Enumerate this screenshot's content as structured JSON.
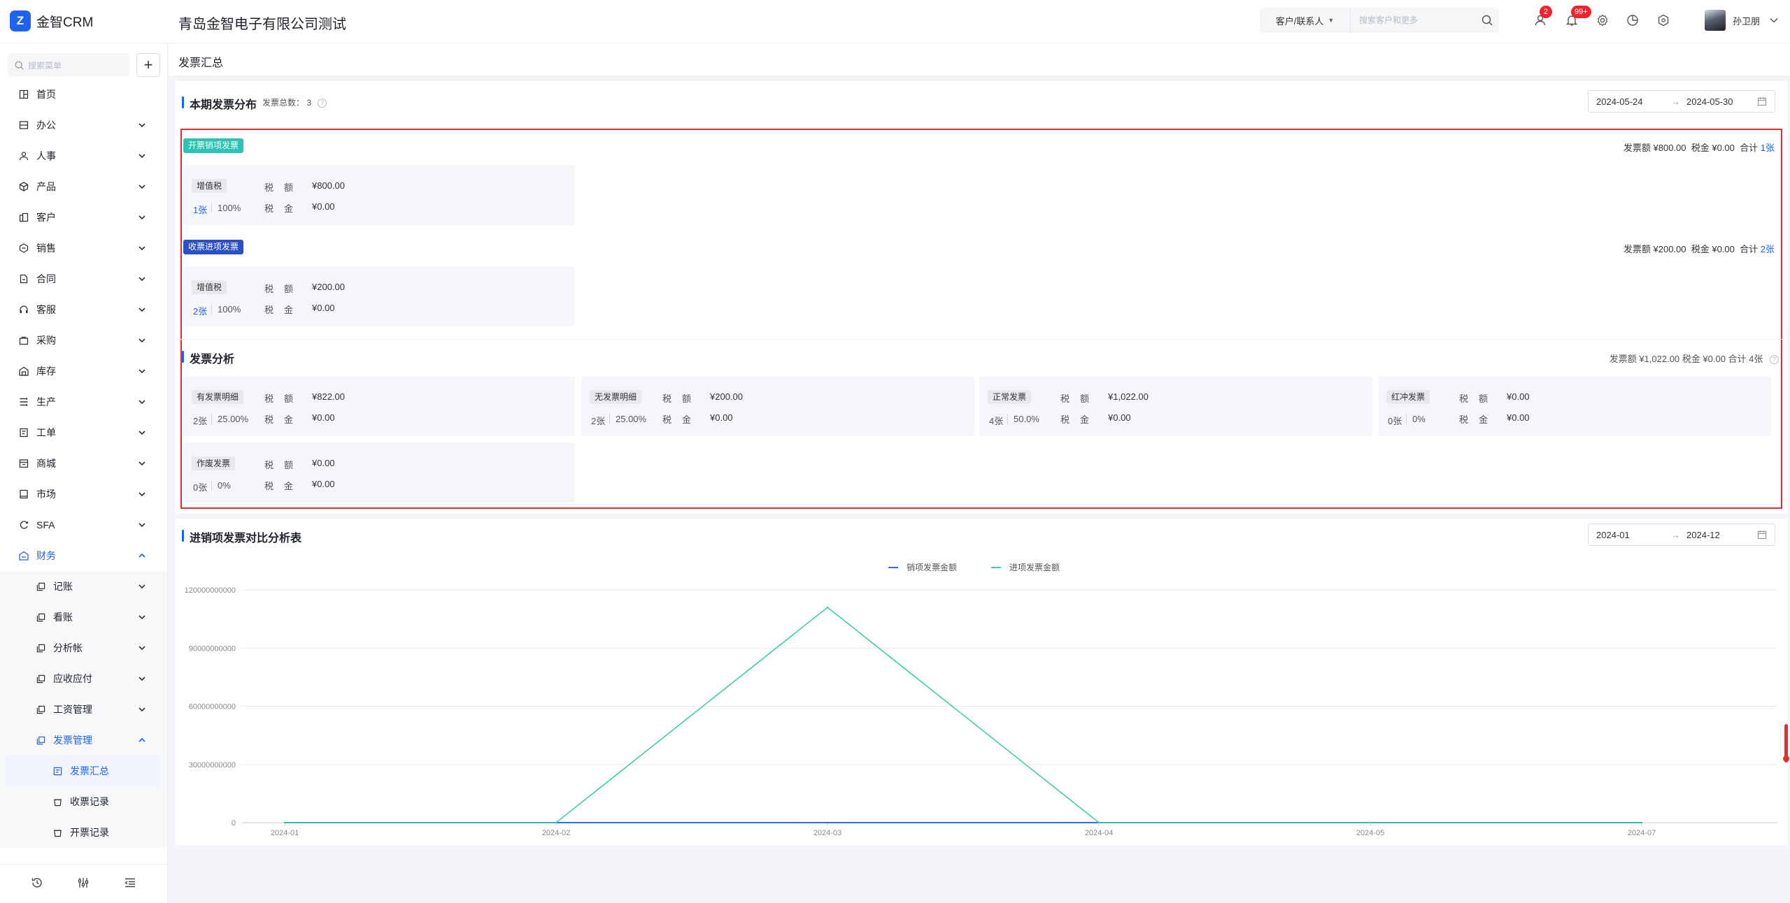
{
  "app": {
    "logo_letter": "Z",
    "name": "金智CRM",
    "company": "青岛金智电子有限公司测试"
  },
  "header": {
    "search_type": "客户/联系人",
    "search_placeholder": "搜索客户和更多",
    "user_badge": "2",
    "notify_badge": "99+",
    "user_name": "孙卫朋",
    "icons": [
      "search-icon",
      "user-icon",
      "bell-icon",
      "gear-icon",
      "chart-icon",
      "shield-icon",
      "chevron-down-icon"
    ]
  },
  "sidebar": {
    "search_placeholder": "搜索菜单",
    "add_label": "+",
    "items": [
      {
        "label": "首页",
        "icon": "home-icon"
      },
      {
        "label": "办公",
        "icon": "office-icon"
      },
      {
        "label": "人事",
        "icon": "people-icon"
      },
      {
        "label": "产品",
        "icon": "cube-icon"
      },
      {
        "label": "客户",
        "icon": "customer-icon"
      },
      {
        "label": "销售",
        "icon": "sales-icon"
      },
      {
        "label": "合同",
        "icon": "contract-icon"
      },
      {
        "label": "客服",
        "icon": "headset-icon"
      },
      {
        "label": "采购",
        "icon": "purchase-icon"
      },
      {
        "label": "库存",
        "icon": "warehouse-icon"
      },
      {
        "label": "生产",
        "icon": "production-icon"
      },
      {
        "label": "工单",
        "icon": "ticket-icon"
      },
      {
        "label": "商城",
        "icon": "shop-icon"
      },
      {
        "label": "市场",
        "icon": "market-icon"
      },
      {
        "label": "SFA",
        "icon": "sfa-icon"
      },
      {
        "label": "财务",
        "icon": "finance-icon"
      }
    ],
    "finance_children": [
      {
        "label": "记账"
      },
      {
        "label": "看账"
      },
      {
        "label": "分析帐"
      },
      {
        "label": "应收应付"
      },
      {
        "label": "工资管理"
      },
      {
        "label": "发票管理"
      }
    ],
    "invoice_children": [
      {
        "label": "发票汇总"
      },
      {
        "label": "收票记录"
      },
      {
        "label": "开票记录"
      }
    ]
  },
  "page": {
    "title": "发票汇总"
  },
  "distribution": {
    "title": "本期发票分布",
    "total_label": "发票总数：",
    "total_count": "3",
    "date_start": "2024-05-24",
    "date_end": "2024-05-30",
    "arrow": "→",
    "groups": [
      {
        "tag": "开票销项发票",
        "summary_amount": "发票额 ¥800.00",
        "summary_tax": "税金 ¥0.00",
        "summary_total_label": "合计",
        "summary_total": "1张",
        "card": {
          "type": "增值税",
          "count": "1张",
          "pct": "100%",
          "k1": "税　额",
          "v1": "¥800.00",
          "k2": "税　金",
          "v2": "¥0.00"
        }
      },
      {
        "tag": "收票进项发票",
        "summary_amount": "发票额 ¥200.00",
        "summary_tax": "税金 ¥0.00",
        "summary_total_label": "合计",
        "summary_total": "2张",
        "card": {
          "type": "增值税",
          "count": "2张",
          "pct": "100%",
          "k1": "税　额",
          "v1": "¥200.00",
          "k2": "税　金",
          "v2": "¥0.00"
        }
      }
    ]
  },
  "analysis": {
    "title": "发票分析",
    "summary": "发票额 ¥1,022.00 税金 ¥0.00 合计 4张",
    "cards": [
      {
        "type": "有发票明细",
        "count": "2张",
        "pct": "25.00%",
        "k1": "税　额",
        "v1": "¥822.00",
        "k2": "税　金",
        "v2": "¥0.00"
      },
      {
        "type": "无发票明细",
        "count": "2张",
        "pct": "25.00%",
        "k1": "税　额",
        "v1": "¥200.00",
        "k2": "税　金",
        "v2": "¥0.00"
      },
      {
        "type": "正常发票",
        "count": "4张",
        "pct": "50.0%",
        "k1": "税　额",
        "v1": "¥1,022.00",
        "k2": "税　金",
        "v2": "¥0.00"
      },
      {
        "type": "红冲发票",
        "count": "0张",
        "pct": "0%",
        "k1": "税　额",
        "v1": "¥0.00",
        "k2": "税　金",
        "v2": "¥0.00"
      },
      {
        "type": "作废发票",
        "count": "0张",
        "pct": "0%",
        "k1": "税　额",
        "v1": "¥0.00",
        "k2": "税　金",
        "v2": "¥0.00"
      }
    ]
  },
  "compare": {
    "title": "进销项发票对比分析表",
    "date_start": "2024-01",
    "date_end": "2024-12",
    "arrow": "→"
  },
  "chart_data": {
    "type": "line",
    "categories": [
      "2024-01",
      "2024-02",
      "2024-03",
      "2024-04",
      "2024-05",
      "2024-07"
    ],
    "series": [
      {
        "name": "销项发票金额",
        "color": "#2f6fe0",
        "values": [
          0,
          0,
          0,
          0,
          0,
          0
        ]
      },
      {
        "name": "进项发票金额",
        "color": "#3ecfa9",
        "values": [
          0,
          0,
          111000000000,
          0,
          0,
          0
        ]
      }
    ],
    "yticks": [
      0,
      30000000000,
      60000000000,
      90000000000,
      120000000000
    ],
    "ylim": [
      0,
      120000000000
    ],
    "grid": true,
    "legend": "top-center"
  }
}
